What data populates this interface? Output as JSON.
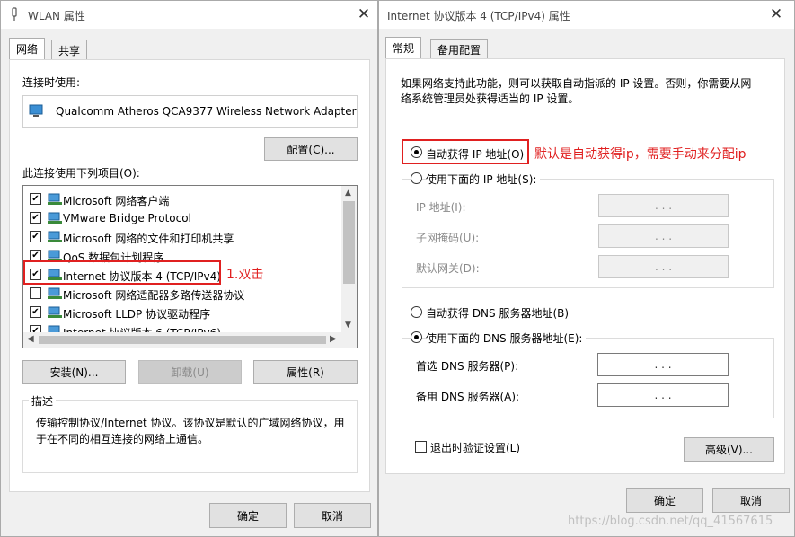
{
  "left_window": {
    "title": "WLAN 属性",
    "tabs": [
      "网络",
      "共享"
    ],
    "connect_using_label": "连接时使用:",
    "adapter_name": "Qualcomm Atheros QCA9377 Wireless Network Adapter",
    "configure_button": "配置(C)...",
    "items_label": "此连接使用下列项目(O):",
    "items": [
      {
        "label": "Microsoft 网络客户端",
        "checked": "✔"
      },
      {
        "label": "VMware Bridge Protocol",
        "checked": "✔"
      },
      {
        "label": "Microsoft 网络的文件和打印机共享",
        "checked": "✔"
      },
      {
        "label": "QoS 数据包计划程序",
        "checked": "✔"
      },
      {
        "label": "Internet 协议版本 4 (TCP/IPv4)",
        "checked": "✔"
      },
      {
        "label": "Microsoft 网络适配器多路传送器协议",
        "checked": ""
      },
      {
        "label": "Microsoft LLDP 协议驱动程序",
        "checked": "✔"
      },
      {
        "label": "Internet 协议版本 6 (TCP/IPv6)",
        "checked": "✔"
      }
    ],
    "annotation": "1.双击",
    "install_button": "安装(N)...",
    "uninstall_button": "卸载(U)",
    "properties_button": "属性(R)",
    "description_label": "描述",
    "description_text_1": "传输控制协议/Internet 协议。该协议是默认的广域网络协议，用",
    "description_text_2": "于在不同的相互连接的网络上通信。",
    "ok_button": "确定",
    "cancel_button": "取消"
  },
  "right_window": {
    "title": "Internet 协议版本 4 (TCP/IPv4) 属性",
    "tabs": [
      "常规",
      "备用配置"
    ],
    "intro_line_1": "如果网络支持此功能，则可以获取自动指派的 IP 设置。否则，你需要从网",
    "intro_line_2": "络系统管理员处获得适当的 IP 设置。",
    "auto_ip_label": "自动获得 IP 地址(O)",
    "annotation": "默认是自动获得ip，需要手动来分配ip",
    "manual_ip_label": "使用下面的 IP 地址(S):",
    "ip_address_label": "IP 地址(I):",
    "subnet_label": "子网掩码(U):",
    "gateway_label": "默认网关(D):",
    "auto_dns_label": "自动获得 DNS 服务器地址(B)",
    "manual_dns_label": "使用下面的 DNS 服务器地址(E):",
    "preferred_dns_label": "首选 DNS 服务器(P):",
    "alternate_dns_label": "备用 DNS 服务器(A):",
    "ip_dots": ".  .  .",
    "validate_label": "退出时验证设置(L)",
    "advanced_button": "高级(V)...",
    "ok_button": "确定",
    "cancel_button": "取消"
  },
  "watermark": "https://blog.csdn.net/qq_41567615",
  "colors": {
    "annotation": "#e02020",
    "button_bg": "#e1e1e1",
    "window_bg": "#f0f0f0"
  }
}
